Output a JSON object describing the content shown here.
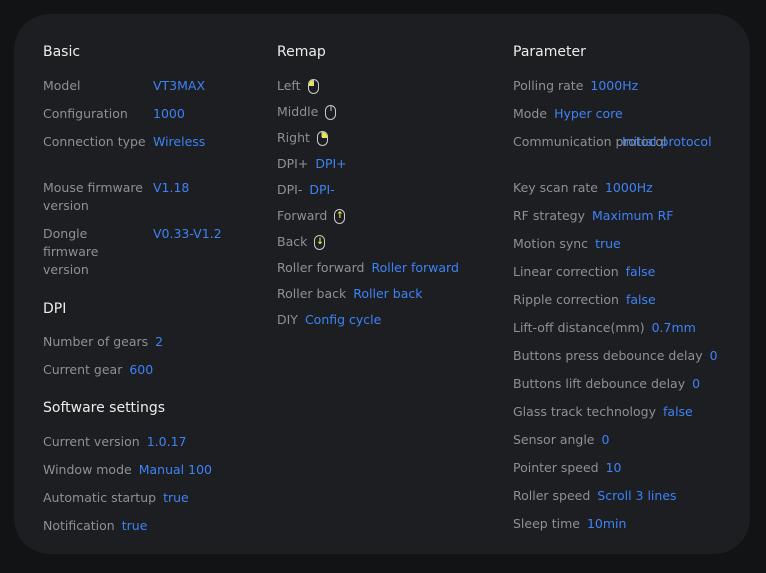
{
  "basic": {
    "title": "Basic",
    "items": [
      {
        "label": "Model",
        "value": "VT3MAX"
      },
      {
        "label": "Configuration",
        "value": "1000"
      },
      {
        "label": "Connection type",
        "value": "Wireless"
      },
      {
        "label": "Mouse firmware version",
        "value": "V1.18"
      },
      {
        "label": "Dongle firmware version",
        "value": "V0.33-V1.2"
      }
    ]
  },
  "dpi": {
    "title": "DPI",
    "items": [
      {
        "label": "Number of gears",
        "value": "2"
      },
      {
        "label": "Current gear",
        "value": "600"
      }
    ]
  },
  "software": {
    "title": "Software settings",
    "items": [
      {
        "label": "Current version",
        "value": "1.0.17"
      },
      {
        "label": "Window mode",
        "value": "Manual 100"
      },
      {
        "label": "Automatic startup",
        "value": "true"
      },
      {
        "label": "Notification",
        "value": "true"
      }
    ]
  },
  "remap": {
    "title": "Remap",
    "items": [
      {
        "label": "Left",
        "value": "",
        "icon": "mouse-left-click-icon"
      },
      {
        "label": "Middle",
        "value": "",
        "icon": "mouse-middle-click-icon"
      },
      {
        "label": "Right",
        "value": "",
        "icon": "mouse-right-click-icon"
      },
      {
        "label": "DPI+",
        "value": "DPI+"
      },
      {
        "label": "DPI-",
        "value": "DPI-"
      },
      {
        "label": "Forward",
        "value": "",
        "icon": "mouse-forward-icon"
      },
      {
        "label": "Back",
        "value": "",
        "icon": "mouse-back-icon"
      },
      {
        "label": "Roller forward",
        "value": "Roller forward"
      },
      {
        "label": "Roller back",
        "value": "Roller back"
      },
      {
        "label": "DIY",
        "value": "Config cycle"
      }
    ]
  },
  "parameter": {
    "title": "Parameter",
    "items": [
      {
        "label": "Polling rate",
        "value": "1000Hz"
      },
      {
        "label": "Mode",
        "value": "Hyper core"
      },
      {
        "label": "Communication protocol",
        "value": "Initial protocol"
      },
      {
        "label": "Key scan rate",
        "value": "1000Hz"
      },
      {
        "label": "RF strategy",
        "value": "Maximum RF"
      },
      {
        "label": "Motion sync",
        "value": "true"
      },
      {
        "label": "Linear correction",
        "value": "false"
      },
      {
        "label": "Ripple correction",
        "value": "false"
      },
      {
        "label": "Lift-off distance(mm)",
        "value": "0.7mm"
      },
      {
        "label": "Buttons press debounce delay",
        "value": "0"
      },
      {
        "label": "Buttons lift debounce delay",
        "value": "0"
      },
      {
        "label": "Glass track technology",
        "value": "false"
      },
      {
        "label": "Sensor angle",
        "value": "0"
      },
      {
        "label": "Pointer speed",
        "value": "10"
      },
      {
        "label": "Roller speed",
        "value": "Scroll 3 lines"
      },
      {
        "label": "Sleep time",
        "value": "10min"
      }
    ]
  },
  "colors": {
    "background": "#121314",
    "panel": "#1c1e21",
    "label": "#8d9096",
    "value": "#3f82f6",
    "heading": "#ececec",
    "icon_accent": "#e9e94a"
  }
}
